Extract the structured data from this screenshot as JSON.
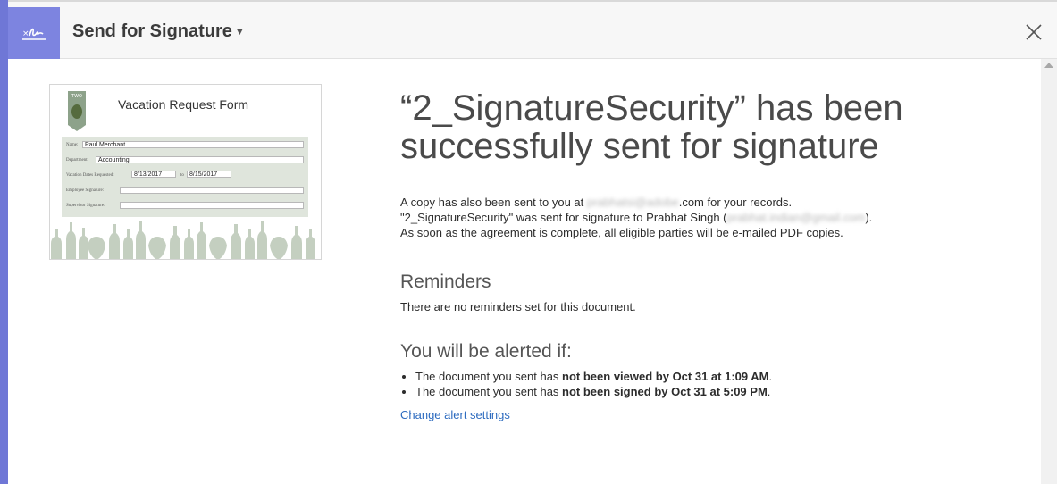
{
  "app": {
    "title": "Send for Signature",
    "logo_icon": "sign-logo-icon",
    "close_icon": "close-icon",
    "accent_color": "#7d84e0"
  },
  "thumbnail": {
    "form_title": "Vacation Request Form",
    "crest_text": "TWO",
    "fields": {
      "name_label": "Name:",
      "name_value": "Paul Merchant",
      "department_label": "Department:",
      "department_value": "Accounting",
      "dates_label": "Vacation Dates Requested:",
      "date_from": "8/13/2017",
      "date_to_label": "to",
      "date_to": "8/15/2017",
      "employee_sig_label": "Employee Signature:",
      "supervisor_sig_label": "Supervisor Signature:"
    }
  },
  "main": {
    "heading_line1": "“2_SignatureSecurity” has been",
    "heading_line2": "successfully sent for signature",
    "copy_prefix": "A copy has also been sent to you at ",
    "copy_email_blurred": "prabhatsi@adobe",
    "copy_suffix": ".com for your records.",
    "sent_prefix": "\"2_SignatureSecurity\" was sent for signature to Prabhat Singh (",
    "sent_email_blurred": "prabhat.indian@gmail.com",
    "sent_suffix": ").",
    "complete_text": "As soon as the agreement is complete, all eligible parties will be e-mailed PDF copies."
  },
  "reminders": {
    "title": "Reminders",
    "text": "There are no reminders set for this document."
  },
  "alerts": {
    "title": "You will be alerted if:",
    "items": [
      {
        "prefix": "The document you sent has ",
        "bold": "not been viewed by Oct 31 at 1:09 AM",
        "suffix": "."
      },
      {
        "prefix": "The document you sent has ",
        "bold": "not been signed by Oct 31 at 5:09 PM",
        "suffix": "."
      }
    ],
    "link": "Change alert settings"
  }
}
